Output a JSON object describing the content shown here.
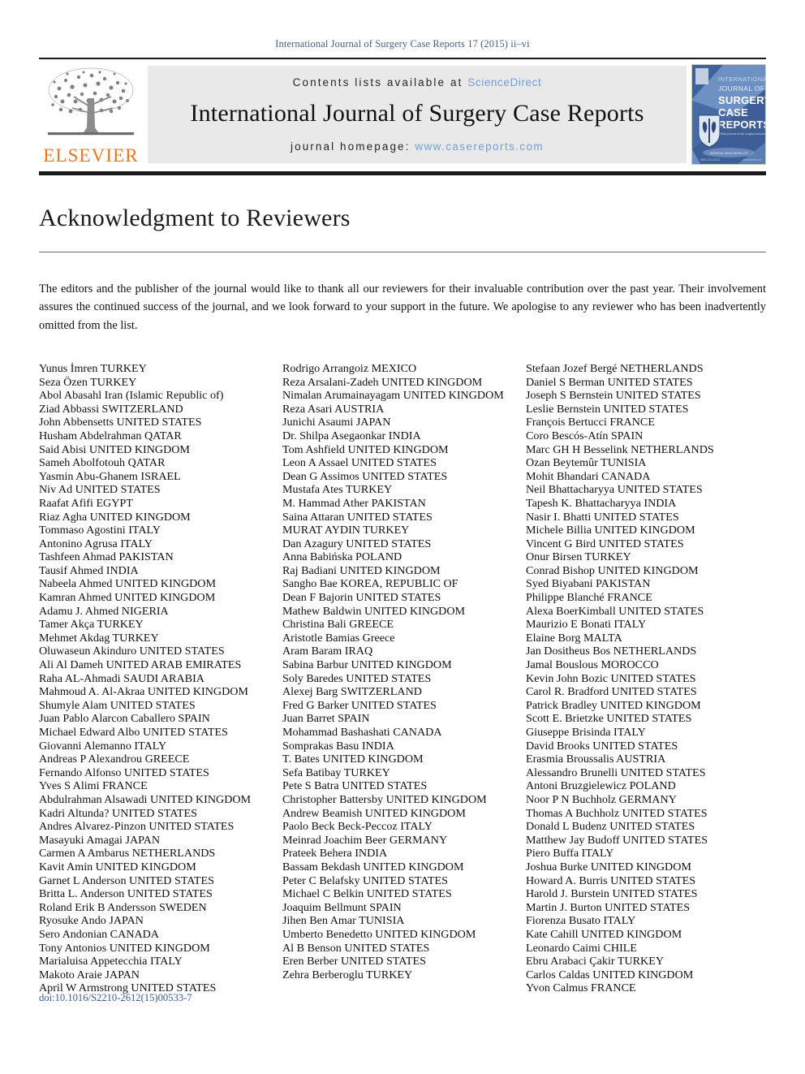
{
  "running_head": "International Journal of Surgery Case Reports 17 (2015) ii–vi",
  "masthead": {
    "publisher_name": "ELSEVIER",
    "contents_prefix": "Contents lists available at",
    "sciencedirect": "ScienceDirect",
    "journal_title": "International Journal of Surgery Case Reports",
    "homepage_prefix": "journal homepage:",
    "homepage_url": "www.casereports.com",
    "cover": {
      "line1": "INTERNATIONAL",
      "line2": "JOURNAL OF",
      "line3": "SURGERY",
      "line4": "CASE",
      "line5": "REPORTS"
    }
  },
  "colors": {
    "elsevier_orange": "#E87722",
    "link_blue": "#6f9fd8",
    "running_head_blue": "#4a5f86",
    "doi_blue": "#3a5b92",
    "banner_grey": "#e9e9e9",
    "cover_blue": "#4a6fa5"
  },
  "article": {
    "title": "Acknowledgment to Reviewers",
    "intro": "The editors and the publisher of the journal would like to thank all our reviewers for their invaluable contribution over the past year. Their involvement assures the continued success of the journal, and we look forward to your support in the future. We apologise to any reviewer who has been inadvertently omitted from the list."
  },
  "doi": "doi:10.1016/S2210-2612(15)00533-7",
  "reviewers": {
    "column1": [
      "Yunus İmren TURKEY",
      "Seza Özen TURKEY",
      "Abol Abasahl Iran (Islamic Republic of)",
      "Ziad Abbassi SWITZERLAND",
      "John Abbensetts UNITED STATES",
      "Husham Abdelrahman QATAR",
      "Said Abisi UNITED KINGDOM",
      "Sameh Abolfotouh QATAR",
      "Yasmin Abu-Ghanem ISRAEL",
      "Niv Ad UNITED STATES",
      "Raafat Afifi EGYPT",
      "Riaz Agha UNITED KINGDOM",
      "Tommaso Agostini ITALY",
      "Antonino Agrusa ITALY",
      "Tashfeen Ahmad PAKISTAN",
      "Tausif Ahmed INDIA",
      "Nabeela Ahmed UNITED KINGDOM",
      "Kamran Ahmed UNITED KINGDOM",
      "Adamu J. Ahmed NIGERIA",
      "Tamer Akça TURKEY",
      "Mehmet Akdag TURKEY",
      "Oluwaseun Akinduro UNITED STATES",
      "Ali Al Dameh UNITED ARAB EMIRATES",
      "Raha AL-Ahmadi SAUDI ARABIA",
      "Mahmoud A. Al-Akraa UNITED KINGDOM",
      "Shumyle Alam UNITED STATES",
      "Juan Pablo Alarcon Caballero SPAIN",
      "Michael Edward Albo UNITED STATES",
      "Giovanni Alemanno ITALY",
      "Andreas P Alexandrou GREECE",
      "Fernando Alfonso UNITED STATES",
      "Yves S Alimi FRANCE",
      "Abdulrahman Alsawadi UNITED KINGDOM",
      "Kadri Altunda? UNITED STATES",
      "Andres Alvarez-Pinzon UNITED STATES",
      "Masayuki Amagai JAPAN",
      "Carmen A Ambarus NETHERLANDS",
      "Kavit Amin UNITED KINGDOM",
      "Garnet L Anderson UNITED STATES",
      "Britta L. Anderson UNITED STATES",
      "Roland Erik B Andersson SWEDEN",
      "Ryosuke Ando JAPAN",
      "Sero Andonian CANADA",
      "Tony Antonios UNITED KINGDOM",
      "Marialuisa Appetecchia ITALY",
      "Makoto Araie JAPAN",
      "April W Armstrong UNITED STATES"
    ],
    "column2": [
      "Rodrigo Arrangoiz MEXICO",
      "Reza Arsalani-Zadeh UNITED KINGDOM",
      "Nimalan Arumainayagam UNITED KINGDOM",
      "Reza Asari AUSTRIA",
      "Junichi Asaumi JAPAN",
      "Dr. Shilpa Asegaonkar INDIA",
      "Tom Ashfield UNITED KINGDOM",
      "Leon A Assael UNITED STATES",
      "Dean G Assimos UNITED STATES",
      "Mustafa Ates TURKEY",
      "M. Hammad Ather PAKISTAN",
      "Saina Attaran UNITED STATES",
      "MURAT AYDIN TURKEY",
      "Dan Azagury UNITED STATES",
      "Anna Babińska POLAND",
      "Raj Badiani UNITED KINGDOM",
      "Sangho Bae KOREA, REPUBLIC OF",
      "Dean F Bajorin UNITED STATES",
      "Mathew Baldwin UNITED KINGDOM",
      "Christina Bali GREECE",
      "Aristotle Bamias Greece",
      "Aram Baram IRAQ",
      "Sabina Barbur UNITED KINGDOM",
      "Soly Baredes UNITED STATES",
      "Alexej Barg SWITZERLAND",
      "Fred G Barker UNITED STATES",
      "Juan Barret SPAIN",
      "Mohammad Bashashati CANADA",
      "Somprakas Basu INDIA",
      "T. Bates UNITED KINGDOM",
      "Sefa Batibay TURKEY",
      "Pete S Batra UNITED STATES",
      "Christopher Battersby UNITED KINGDOM",
      "Andrew Beamish UNITED KINGDOM",
      "Paolo Beck Beck-Peccoz ITALY",
      "Meinrad Joachim Beer GERMANY",
      "Prateek Behera INDIA",
      "Bassam Bekdash UNITED KINGDOM",
      "Peter C Belafsky UNITED STATES",
      "Michael C Belkin UNITED STATES",
      "Joaquim Bellmunt SPAIN",
      "Jihen Ben Amar TUNISIA",
      "Umberto Benedetto UNITED KINGDOM",
      "Al B Benson UNITED STATES",
      "Eren Berber UNITED STATES",
      "Zehra Berberoglu TURKEY"
    ],
    "column3": [
      "Stefaan Jozef Bergé NETHERLANDS",
      "Daniel S Berman UNITED STATES",
      "Joseph S Bernstein UNITED STATES",
      "Leslie Bernstein UNITED STATES",
      "François Bertucci FRANCE",
      "Coro Bescós-Atín SPAIN",
      "Marc GH H Besselink NETHERLANDS",
      "Ozan Beytemûr TUNISIA",
      "Mohit Bhandari CANADA",
      "Neil Bhattacharyya UNITED STATES",
      "Tapesh K. Bhattacharyya INDIA",
      "Nasir I. Bhatti UNITED STATES",
      "Michele Billia UNITED KINGDOM",
      "Vincent G Bird UNITED STATES",
      "Onur Birsen TURKEY",
      "Conrad Bishop UNITED KINGDOM",
      "Syed Biyabani PAKISTAN",
      "Philippe Blanché FRANCE",
      "Alexa BoerKimball UNITED STATES",
      "Maurizio E Bonati ITALY",
      "Elaine Borg MALTA",
      "Jan Dositheus Bos NETHERLANDS",
      "Jamal Bouslous MOROCCO",
      "Kevin John Bozic UNITED STATES",
      "Carol R. Bradford UNITED STATES",
      "Patrick Bradley UNITED KINGDOM",
      "Scott E. Brietzke UNITED STATES",
      "Giuseppe Brisinda ITALY",
      "David Brooks UNITED STATES",
      "Erasmia Broussalis AUSTRIA",
      "Alessandro Brunelli UNITED STATES",
      "Antoni Bruzgielewicz POLAND",
      "Noor P N Buchholz GERMANY",
      "Thomas A Buchholz UNITED STATES",
      "Donald L Budenz UNITED STATES",
      "Matthew Jay Budoff UNITED STATES",
      "Piero Buffa ITALY",
      "Joshua Burke UNITED KINGDOM",
      "Howard A. Burris UNITED STATES",
      "Harold J. Burstein UNITED STATES",
      "Martin J. Burton UNITED STATES",
      "Fiorenza Busato ITALY",
      "Kate Cahill UNITED KINGDOM",
      "Leonardo Caimi CHILE",
      "Ebru Arabaci Çakir TURKEY",
      "Carlos Caldas UNITED KINGDOM",
      "Yvon Calmus FRANCE"
    ]
  }
}
